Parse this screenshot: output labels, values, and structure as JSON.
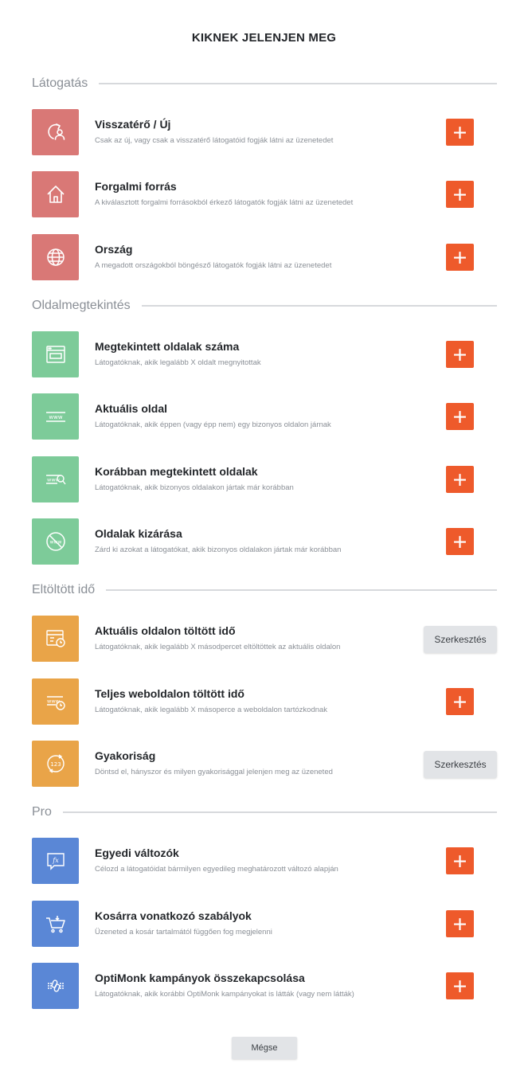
{
  "title": "KIKNEK JELENJEN MEG",
  "sections": [
    {
      "label": "Látogatás",
      "color": "#d97876"
    },
    {
      "label": "Oldalmegtekintés",
      "color": "#7dcb99"
    },
    {
      "label": "Eltöltött idő",
      "color": "#e9a448"
    },
    {
      "label": "Pro",
      "color": "#5a87d6"
    }
  ],
  "items": [
    {
      "name": "Visszatérő / Új",
      "desc": "Csak az új, vagy csak a visszatérő látogatóid fogják látni az üzenetedet",
      "icon": "returning-user-icon",
      "action": "add"
    },
    {
      "name": "Forgalmi forrás",
      "desc": "A kiválasztott forgalmi forrásokból érkező látogatók fogják látni az üzenetedet",
      "icon": "home-icon",
      "action": "add"
    },
    {
      "name": "Ország",
      "desc": "A megadott országokból böngésző látogatók fogják látni az üzenetedet",
      "icon": "globe-icon",
      "action": "add"
    },
    {
      "name": "Megtekintett oldalak száma",
      "desc": "Látogatóknak, akik legalább X oldalt megnyitottak",
      "icon": "browser-window-icon",
      "action": "add"
    },
    {
      "name": "Aktuális oldal",
      "desc": "Látogatóknak, akik éppen (vagy épp nem) egy bizonyos oldalon járnak",
      "icon": "www-icon",
      "action": "add"
    },
    {
      "name": "Korábban megtekintett oldalak",
      "desc": "Látogatóknak, akik bizonyos oldalakon jártak már korábban",
      "icon": "www-search-icon",
      "action": "add"
    },
    {
      "name": "Oldalak kizárása",
      "desc": "Zárd ki azokat a látogatókat, akik bizonyos oldalakon jártak már korábban",
      "icon": "www-blocked-icon",
      "action": "add"
    },
    {
      "name": "Aktuális oldalon töltött idő",
      "desc": "Látogatóknak, akik legalább X másodpercet eltöltöttek az aktuális oldalon",
      "icon": "page-clock-icon",
      "action": "edit"
    },
    {
      "name": "Teljes weboldalon töltött idő",
      "desc": "Látogatóknak, akik legalább X másoperce a weboldalon tartózkodnak",
      "icon": "www-clock-icon",
      "action": "add"
    },
    {
      "name": "Gyakoriság",
      "desc": "Döntsd el, hányszor és milyen gyakorisággal jelenjen meg az üzeneted",
      "icon": "frequency-123-icon",
      "action": "edit"
    },
    {
      "name": "Egyedi változók",
      "desc": "Célozd a látogatóidat bármilyen egyedileg meghatározott változó alapján",
      "icon": "fx-variable-icon",
      "action": "add"
    },
    {
      "name": "Kosárra vonatkozó szabályok",
      "desc": "Üzeneted a kosár tartalmától függően fog megjelenni",
      "icon": "cart-icon",
      "action": "add"
    },
    {
      "name": "OptiMonk kampányok összekapcsolása",
      "desc": "Látogatóknak, akik korábbi OptiMonk kampányokat is látták (vagy nem látták)",
      "icon": "link-campaigns-icon",
      "action": "add"
    }
  ],
  "edit_label": "Szerkesztés",
  "cancel_label": "Mégse",
  "accent_color": "#ee5a2b"
}
